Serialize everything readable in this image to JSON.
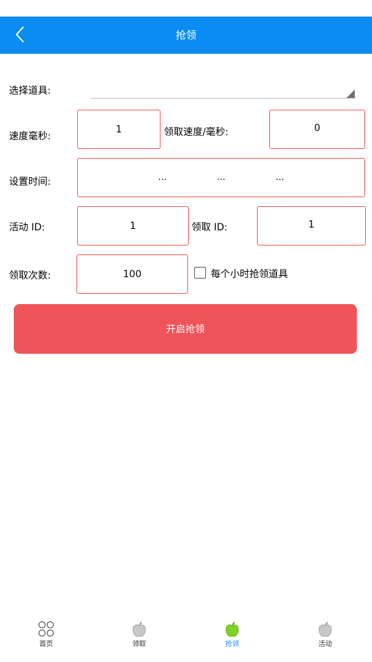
{
  "header": {
    "title": "抢领"
  },
  "form": {
    "select_item_label": "选择道具:",
    "select_item_value": "",
    "speed_ms_label": "速度毫秒:",
    "speed_ms_value": "1",
    "claim_speed_label": "领取速度/毫秒:",
    "claim_speed_value": "0",
    "set_time_label": "设置时间:",
    "time_parts": [
      "...",
      "...",
      "..."
    ],
    "activity_id_label": "活动 ID:",
    "activity_id_value": "1",
    "claim_id_label": "领取 ID:",
    "claim_id_value": "1",
    "claim_count_label": "领取次数:",
    "claim_count_value": "100",
    "hourly_checkbox_label": "每个小时抢领道具",
    "hourly_checkbox_checked": false
  },
  "start_button_label": "开启抢领",
  "tabs": [
    {
      "label": "首页",
      "icon": "grid-icon",
      "active": false
    },
    {
      "label": "领取",
      "icon": "apple-icon",
      "active": false
    },
    {
      "label": "抢领",
      "icon": "apple-icon",
      "active": true
    },
    {
      "label": "活动",
      "icon": "apple-icon",
      "active": false
    }
  ],
  "colors": {
    "app_bar": "#0a8cf2",
    "field_border": "#e8584f",
    "button": "#ef545a",
    "tab_active": "#1a8ef0",
    "active_icon": "#7ed321"
  }
}
